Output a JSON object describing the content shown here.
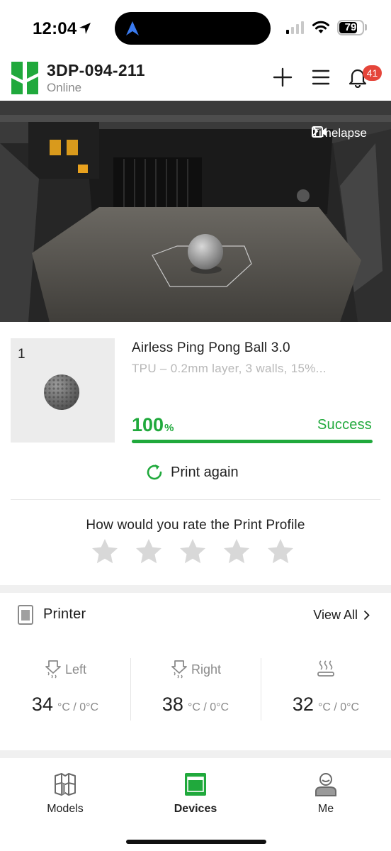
{
  "status_bar": {
    "time": "12:04",
    "battery": "79",
    "battery_level": 0.79,
    "signal_bars_active": 1
  },
  "header": {
    "device_name": "3DP-094-211",
    "device_status": "Online",
    "notification_count": "41",
    "brand_color": "#20a93c"
  },
  "camera": {
    "timelapse_label": "Timelapse"
  },
  "job": {
    "plate_number": "1",
    "name": "Airless Ping Pong Ball 3.0",
    "spec": "TPU – 0.2mm layer, 3 walls, 15%...",
    "progress": "100",
    "progress_unit": "%",
    "progress_value": 100,
    "state": "Success",
    "print_again_label": "Print again"
  },
  "rating": {
    "question": "How would you rate the Print Profile",
    "stars_total": 5,
    "stars_selected": 0
  },
  "printer": {
    "title": "Printer",
    "view_all_label": "View All",
    "temps": [
      {
        "label": "Left",
        "current": "34",
        "rest": "°C / 0°C"
      },
      {
        "label": "Right",
        "current": "38",
        "rest": "°C / 0°C"
      },
      {
        "label": "",
        "current": "32",
        "rest": "°C / 0°C"
      }
    ]
  },
  "tabbar": {
    "models": "Models",
    "devices": "Devices",
    "me": "Me"
  }
}
